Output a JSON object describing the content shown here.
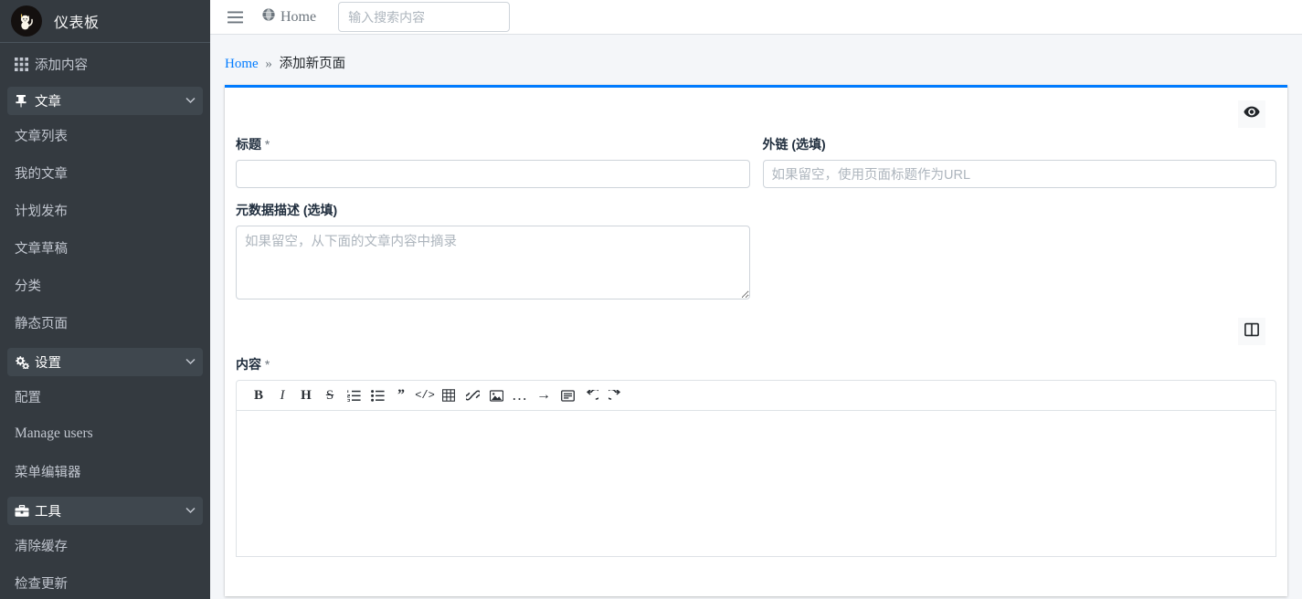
{
  "sidebar": {
    "brand_title": "仪表板",
    "logo_icon": "cat-avatar-icon",
    "items": [
      {
        "label": "添加内容",
        "icon": "grid-icon",
        "type": "link"
      },
      {
        "label": "文章",
        "icon": "thumbtack-icon",
        "type": "group",
        "caret": "⌄"
      },
      {
        "label": "文章列表",
        "type": "sub"
      },
      {
        "label": "我的文章",
        "type": "sub"
      },
      {
        "label": "计划发布",
        "type": "sub"
      },
      {
        "label": "文章草稿",
        "type": "sub"
      },
      {
        "label": "分类",
        "type": "sub"
      },
      {
        "label": "静态页面",
        "type": "sub"
      },
      {
        "label": "设置",
        "icon": "gears-icon",
        "type": "group",
        "caret": "⌄"
      },
      {
        "label": "配置",
        "type": "sub"
      },
      {
        "label": "Manage users",
        "type": "sub",
        "latin": true
      },
      {
        "label": "菜单编辑器",
        "type": "sub"
      },
      {
        "label": "工具",
        "icon": "briefcase-icon",
        "type": "group",
        "caret": "⌄"
      },
      {
        "label": "清除缓存",
        "type": "sub"
      },
      {
        "label": "检查更新",
        "type": "sub"
      }
    ]
  },
  "topbar": {
    "menu_toggle_icon": "hamburger-icon",
    "home_label": "Home",
    "home_icon": "globe-icon",
    "search_placeholder": "输入搜索内容",
    "search_value": ""
  },
  "breadcrumb": {
    "home": "Home",
    "separator": "»",
    "current": "添加新页面"
  },
  "form": {
    "preview_icon": "eye-icon",
    "split_view_icon": "columns-icon",
    "title_label": "标题",
    "title_required_mark": "*",
    "title_value": "",
    "title_placeholder": "",
    "slug_label": "外链 (选填)",
    "slug_value": "",
    "slug_placeholder": "如果留空，使用页面标题作为URL",
    "meta_label": "元数据描述 (选填)",
    "meta_value": "",
    "meta_placeholder": "如果留空，从下面的文章内容中摘录",
    "content_label": "内容",
    "content_required_mark": "*",
    "content_value": "",
    "content_placeholder": ""
  },
  "editor_toolbar": {
    "buttons": [
      {
        "name": "bold",
        "glyph": "B"
      },
      {
        "name": "italic",
        "glyph": "I"
      },
      {
        "name": "heading",
        "glyph": "H"
      },
      {
        "name": "strikethrough",
        "glyph": "S"
      },
      {
        "name": "ordered-list",
        "glyph": ""
      },
      {
        "name": "unordered-list",
        "glyph": ""
      },
      {
        "name": "quote",
        "glyph": "”"
      },
      {
        "name": "code",
        "glyph": "</>"
      },
      {
        "name": "table",
        "glyph": ""
      },
      {
        "name": "link",
        "glyph": ""
      },
      {
        "name": "image",
        "glyph": ""
      },
      {
        "name": "more",
        "glyph": "…"
      },
      {
        "name": "insert-arrow",
        "glyph": "→"
      },
      {
        "name": "form-block",
        "glyph": ""
      },
      {
        "name": "undo",
        "glyph": "↺"
      },
      {
        "name": "redo",
        "glyph": "↻"
      }
    ]
  },
  "colors": {
    "sidebar_bg": "#343a40",
    "accent": "#007bff",
    "card_top_border": "#007bff",
    "page_bg": "#f4f6f9"
  }
}
